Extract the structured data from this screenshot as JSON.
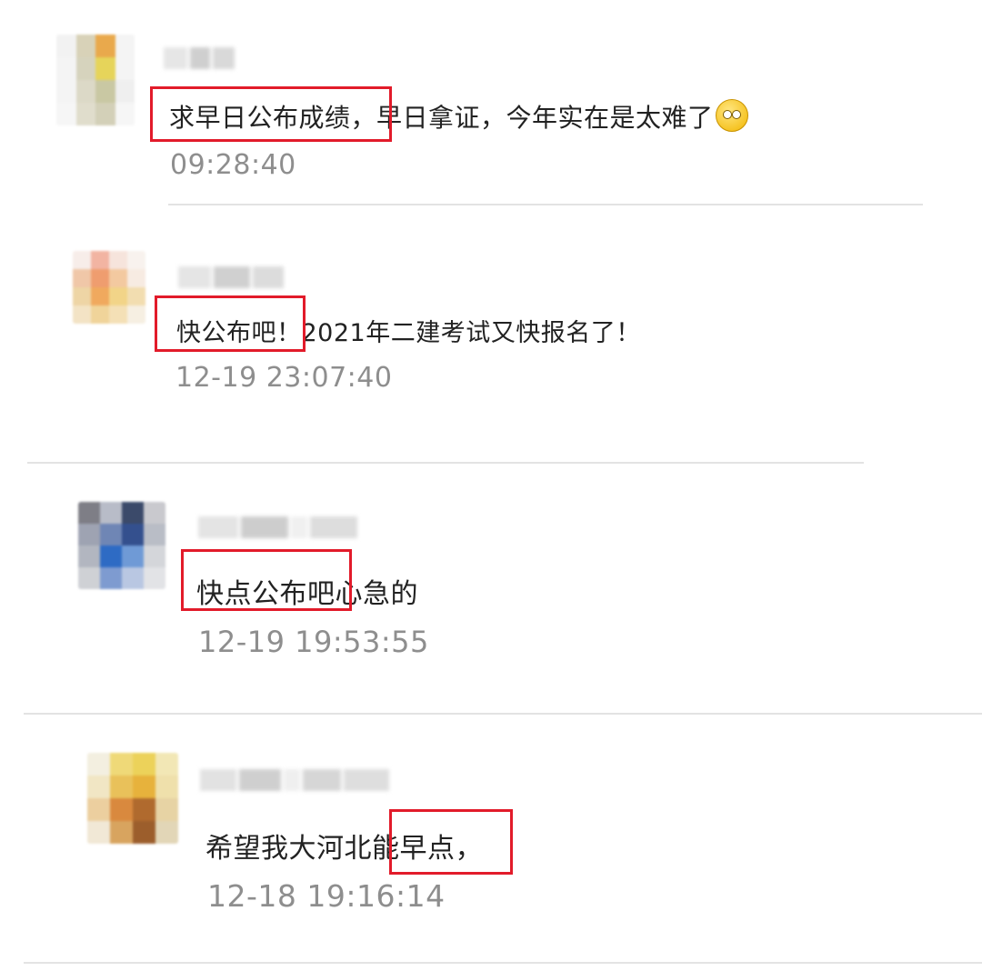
{
  "comments": [
    {
      "text": "求早日公布成绩，早日拿证，今年实在是太难了",
      "emoji": "smiling-face-icon",
      "time": "09:28:40",
      "highlight": "求早日公布成绩"
    },
    {
      "text": "快公布吧！2021年二建考试又快报名了！",
      "time": "12-19 23:07:40",
      "highlight": "快公布吧！"
    },
    {
      "text": "快点公布吧心急的",
      "time": "12-19 19:53:55",
      "highlight": "快点公布吧"
    },
    {
      "text": "希望我大河北能早点，",
      "time": "12-18 19:16:14",
      "highlight": "能早点，"
    }
  ],
  "colors": {
    "highlight_border": "#e21b2a",
    "time_text": "#8e8e8e",
    "comment_text": "#222222",
    "divider": "#e3e3e3"
  }
}
